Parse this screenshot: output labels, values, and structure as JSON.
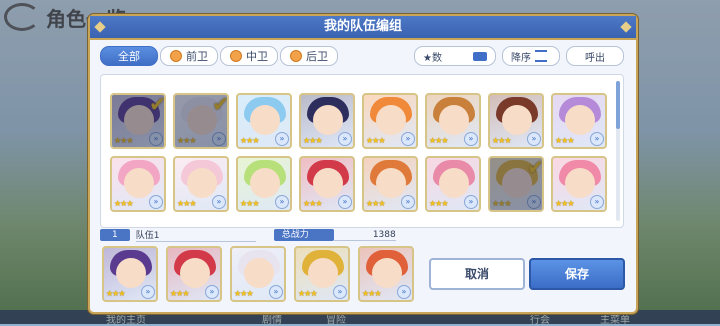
{
  "background": {
    "screen_title": "角色一览",
    "nav_items": [
      "我的主页",
      "剧情",
      "冒险",
      "行会",
      "主菜单"
    ]
  },
  "dialog": {
    "title": "我的队伍编组",
    "filter_tabs": [
      {
        "label": "全部",
        "active": true
      },
      {
        "label": "前卫",
        "active": false
      },
      {
        "label": "中卫",
        "active": false
      },
      {
        "label": "后卫",
        "active": false
      }
    ],
    "sort_key_label": "★数",
    "sort_order_label": "降序",
    "call_label": "呼出",
    "roster": [
      {
        "hair": "#5b3b8f",
        "stars": "★★★",
        "selected": true
      },
      {
        "hair": "#e8e4ef",
        "stars": "★★★",
        "selected": true
      },
      {
        "hair": "#8ccaf0",
        "stars": "★★★",
        "selected": false
      },
      {
        "hair": "#2e2e5e",
        "stars": "★★★",
        "selected": false
      },
      {
        "hair": "#f08a3a",
        "stars": "★★★",
        "selected": false
      },
      {
        "hair": "#c9803a",
        "stars": "★★★",
        "selected": false
      },
      {
        "hair": "#7a3a2a",
        "stars": "★★★",
        "selected": false
      },
      {
        "hair": "#b58ad8",
        "stars": "★★★",
        "selected": false
      },
      {
        "hair": "#f2a6c4",
        "stars": "★★★",
        "selected": false
      },
      {
        "hair": "#f5c8d8",
        "stars": "★★★",
        "selected": false
      },
      {
        "hair": "#b8e07a",
        "stars": "★★★",
        "selected": false
      },
      {
        "hair": "#d23a4a",
        "stars": "★★★",
        "selected": false
      },
      {
        "hair": "#e07a3a",
        "stars": "★★★",
        "selected": false
      },
      {
        "hair": "#e88aa8",
        "stars": "★★★",
        "selected": false
      },
      {
        "hair": "#e0b23a",
        "stars": "★★★",
        "selected": true
      },
      {
        "hair": "#f08aa8",
        "stars": "★★★",
        "selected": false
      }
    ],
    "team_number": "1",
    "team_name": "队伍1",
    "power_label": "总战力",
    "power_value": "1388",
    "team": [
      {
        "hair": "#5b3b8f",
        "stars": "★★★"
      },
      {
        "hair": "#d23a4a",
        "stars": "★★★"
      },
      {
        "hair": "#e8e4ef",
        "stars": "★★★"
      },
      {
        "hair": "#e0b23a",
        "stars": "★★★"
      },
      {
        "hair": "#e0603a",
        "stars": "★★★"
      }
    ],
    "cancel_label": "取消",
    "save_label": "保存"
  }
}
